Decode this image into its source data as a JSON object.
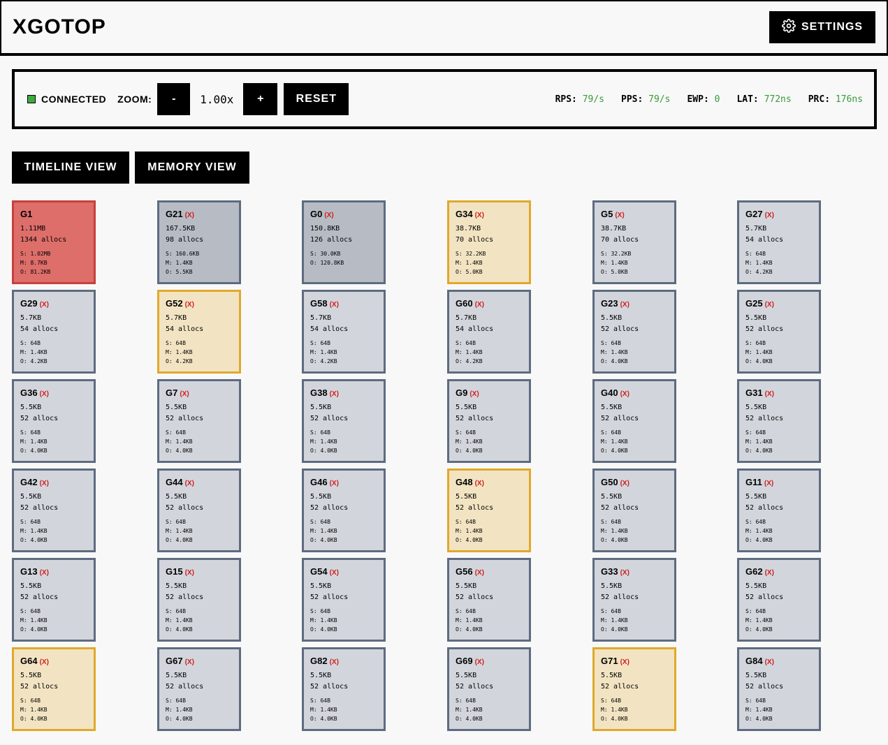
{
  "app": {
    "title": "XGOTOP",
    "settings_label": "SETTINGS"
  },
  "toolbar": {
    "status": "CONNECTED",
    "status_color": "#3cab3c",
    "zoom_label": "ZOOM:",
    "zoom_out": "-",
    "zoom_value": "1.00x",
    "zoom_in": "+",
    "reset_label": "RESET",
    "stats": [
      {
        "key": "RPS:",
        "value": "79/s"
      },
      {
        "key": "PPS:",
        "value": "79/s"
      },
      {
        "key": "EWP:",
        "value": "0"
      },
      {
        "key": "LAT:",
        "value": "772ns"
      },
      {
        "key": "PRC:",
        "value": "176ns"
      }
    ]
  },
  "views": {
    "timeline": "TIMELINE VIEW",
    "memory": "MEMORY VIEW"
  },
  "goroutines": [
    {
      "name": "G1",
      "x": "",
      "size": "1.11MB",
      "allocs": "1344 allocs",
      "s": "S: 1.02MB",
      "m": "M: 8.7KB",
      "o": "O: 81.2KB",
      "tone": "red"
    },
    {
      "name": "G21",
      "x": "(X)",
      "size": "167.5KB",
      "allocs": "98 allocs",
      "s": "S: 160.6KB",
      "m": "M: 1.4KB",
      "o": "O: 5.5KB",
      "tone": "dark"
    },
    {
      "name": "G0",
      "x": "(X)",
      "size": "150.8KB",
      "allocs": "126 allocs",
      "s": "S: 30.0KB",
      "m": "",
      "o": "O: 120.8KB",
      "tone": "dark"
    },
    {
      "name": "G34",
      "x": "(X)",
      "size": "38.7KB",
      "allocs": "70 allocs",
      "s": "S: 32.2KB",
      "m": "M: 1.4KB",
      "o": "O: 5.0KB",
      "tone": "yellow"
    },
    {
      "name": "G5",
      "x": "(X)",
      "size": "38.7KB",
      "allocs": "70 allocs",
      "s": "S: 32.2KB",
      "m": "M: 1.4KB",
      "o": "O: 5.0KB",
      "tone": "gray"
    },
    {
      "name": "G27",
      "x": "(X)",
      "size": "5.7KB",
      "allocs": "54 allocs",
      "s": "S: 64B",
      "m": "M: 1.4KB",
      "o": "O: 4.2KB",
      "tone": "gray"
    },
    {
      "name": "G29",
      "x": "(X)",
      "size": "5.7KB",
      "allocs": "54 allocs",
      "s": "S: 64B",
      "m": "M: 1.4KB",
      "o": "O: 4.2KB",
      "tone": "gray"
    },
    {
      "name": "G52",
      "x": "(X)",
      "size": "5.7KB",
      "allocs": "54 allocs",
      "s": "S: 64B",
      "m": "M: 1.4KB",
      "o": "O: 4.2KB",
      "tone": "yellow"
    },
    {
      "name": "G58",
      "x": "(X)",
      "size": "5.7KB",
      "allocs": "54 allocs",
      "s": "S: 64B",
      "m": "M: 1.4KB",
      "o": "O: 4.2KB",
      "tone": "gray"
    },
    {
      "name": "G60",
      "x": "(X)",
      "size": "5.7KB",
      "allocs": "54 allocs",
      "s": "S: 64B",
      "m": "M: 1.4KB",
      "o": "O: 4.2KB",
      "tone": "gray"
    },
    {
      "name": "G23",
      "x": "(X)",
      "size": "5.5KB",
      "allocs": "52 allocs",
      "s": "S: 64B",
      "m": "M: 1.4KB",
      "o": "O: 4.0KB",
      "tone": "gray"
    },
    {
      "name": "G25",
      "x": "(X)",
      "size": "5.5KB",
      "allocs": "52 allocs",
      "s": "S: 64B",
      "m": "M: 1.4KB",
      "o": "O: 4.0KB",
      "tone": "gray"
    },
    {
      "name": "G36",
      "x": "(X)",
      "size": "5.5KB",
      "allocs": "52 allocs",
      "s": "S: 64B",
      "m": "M: 1.4KB",
      "o": "O: 4.0KB",
      "tone": "gray"
    },
    {
      "name": "G7",
      "x": "(X)",
      "size": "5.5KB",
      "allocs": "52 allocs",
      "s": "S: 64B",
      "m": "M: 1.4KB",
      "o": "O: 4.0KB",
      "tone": "gray"
    },
    {
      "name": "G38",
      "x": "(X)",
      "size": "5.5KB",
      "allocs": "52 allocs",
      "s": "S: 64B",
      "m": "M: 1.4KB",
      "o": "O: 4.0KB",
      "tone": "gray"
    },
    {
      "name": "G9",
      "x": "(X)",
      "size": "5.5KB",
      "allocs": "52 allocs",
      "s": "S: 64B",
      "m": "M: 1.4KB",
      "o": "O: 4.0KB",
      "tone": "gray"
    },
    {
      "name": "G40",
      "x": "(X)",
      "size": "5.5KB",
      "allocs": "52 allocs",
      "s": "S: 64B",
      "m": "M: 1.4KB",
      "o": "O: 4.0KB",
      "tone": "gray"
    },
    {
      "name": "G31",
      "x": "(X)",
      "size": "5.5KB",
      "allocs": "52 allocs",
      "s": "S: 64B",
      "m": "M: 1.4KB",
      "o": "O: 4.0KB",
      "tone": "gray"
    },
    {
      "name": "G42",
      "x": "(X)",
      "size": "5.5KB",
      "allocs": "52 allocs",
      "s": "S: 64B",
      "m": "M: 1.4KB",
      "o": "O: 4.0KB",
      "tone": "gray"
    },
    {
      "name": "G44",
      "x": "(X)",
      "size": "5.5KB",
      "allocs": "52 allocs",
      "s": "S: 64B",
      "m": "M: 1.4KB",
      "o": "O: 4.0KB",
      "tone": "gray"
    },
    {
      "name": "G46",
      "x": "(X)",
      "size": "5.5KB",
      "allocs": "52 allocs",
      "s": "S: 64B",
      "m": "M: 1.4KB",
      "o": "O: 4.0KB",
      "tone": "gray"
    },
    {
      "name": "G48",
      "x": "(X)",
      "size": "5.5KB",
      "allocs": "52 allocs",
      "s": "S: 64B",
      "m": "M: 1.4KB",
      "o": "O: 4.0KB",
      "tone": "yellow"
    },
    {
      "name": "G50",
      "x": "(X)",
      "size": "5.5KB",
      "allocs": "52 allocs",
      "s": "S: 64B",
      "m": "M: 1.4KB",
      "o": "O: 4.0KB",
      "tone": "gray"
    },
    {
      "name": "G11",
      "x": "(X)",
      "size": "5.5KB",
      "allocs": "52 allocs",
      "s": "S: 64B",
      "m": "M: 1.4KB",
      "o": "O: 4.0KB",
      "tone": "gray"
    },
    {
      "name": "G13",
      "x": "(X)",
      "size": "5.5KB",
      "allocs": "52 allocs",
      "s": "S: 64B",
      "m": "M: 1.4KB",
      "o": "O: 4.0KB",
      "tone": "gray"
    },
    {
      "name": "G15",
      "x": "(X)",
      "size": "5.5KB",
      "allocs": "52 allocs",
      "s": "S: 64B",
      "m": "M: 1.4KB",
      "o": "O: 4.0KB",
      "tone": "gray"
    },
    {
      "name": "G54",
      "x": "(X)",
      "size": "5.5KB",
      "allocs": "52 allocs",
      "s": "S: 64B",
      "m": "M: 1.4KB",
      "o": "O: 4.0KB",
      "tone": "gray"
    },
    {
      "name": "G56",
      "x": "(X)",
      "size": "5.5KB",
      "allocs": "52 allocs",
      "s": "S: 64B",
      "m": "M: 1.4KB",
      "o": "O: 4.0KB",
      "tone": "gray"
    },
    {
      "name": "G33",
      "x": "(X)",
      "size": "5.5KB",
      "allocs": "52 allocs",
      "s": "S: 64B",
      "m": "M: 1.4KB",
      "o": "O: 4.0KB",
      "tone": "gray"
    },
    {
      "name": "G62",
      "x": "(X)",
      "size": "5.5KB",
      "allocs": "52 allocs",
      "s": "S: 64B",
      "m": "M: 1.4KB",
      "o": "O: 4.0KB",
      "tone": "gray"
    },
    {
      "name": "G64",
      "x": "(X)",
      "size": "5.5KB",
      "allocs": "52 allocs",
      "s": "S: 64B",
      "m": "M: 1.4KB",
      "o": "O: 4.0KB",
      "tone": "yellow"
    },
    {
      "name": "G67",
      "x": "(X)",
      "size": "5.5KB",
      "allocs": "52 allocs",
      "s": "S: 64B",
      "m": "M: 1.4KB",
      "o": "O: 4.0KB",
      "tone": "gray"
    },
    {
      "name": "G82",
      "x": "(X)",
      "size": "5.5KB",
      "allocs": "52 allocs",
      "s": "S: 64B",
      "m": "M: 1.4KB",
      "o": "O: 4.0KB",
      "tone": "gray"
    },
    {
      "name": "G69",
      "x": "(X)",
      "size": "5.5KB",
      "allocs": "52 allocs",
      "s": "S: 64B",
      "m": "M: 1.4KB",
      "o": "O: 4.0KB",
      "tone": "gray"
    },
    {
      "name": "G71",
      "x": "(X)",
      "size": "5.5KB",
      "allocs": "52 allocs",
      "s": "S: 64B",
      "m": "M: 1.4KB",
      "o": "O: 4.0KB",
      "tone": "yellow"
    },
    {
      "name": "G84",
      "x": "(X)",
      "size": "5.5KB",
      "allocs": "52 allocs",
      "s": "S: 64B",
      "m": "M: 1.4KB",
      "o": "O: 4.0KB",
      "tone": "gray"
    }
  ]
}
